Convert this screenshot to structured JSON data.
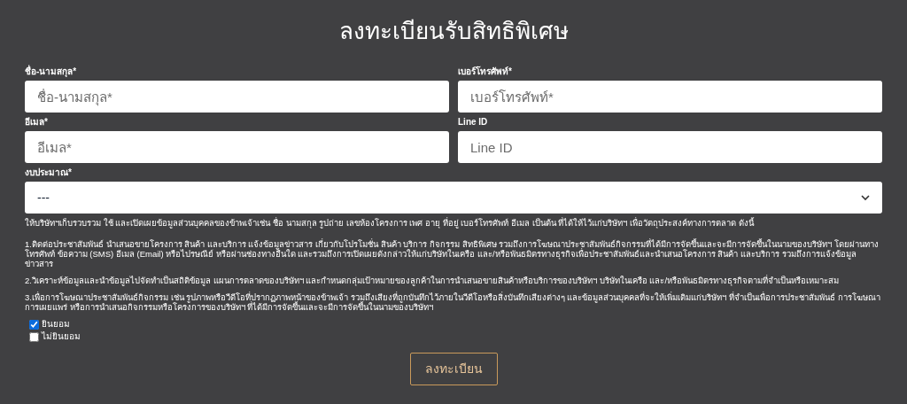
{
  "title": "ลงทะเบียนรับสิทธิพิเศษ",
  "fields": [
    {
      "label": "ชื่อ-นามสกุล*",
      "placeholder": "ชื่อ-นามสกุล*"
    },
    {
      "label": "เบอร์โทรศัพท์*",
      "placeholder": "เบอร์โทรศัพท์*"
    },
    {
      "label": "อีเมล*",
      "placeholder": "อีเมล*"
    },
    {
      "label": "Line ID",
      "placeholder": "Line ID"
    }
  ],
  "budget": {
    "label": "งบประมาณ*",
    "value": "---"
  },
  "consent_intro": "ให้บริษัทฯเก็บรวบรวม ใช้ และเปิดเผยข้อมูลส่วนบุคคลของข้าพเจ้าเช่น ชื่อ นามสกุล รูปถ่าย เลขห้องโครงการ เพศ อายุ ที่อยู่ เบอร์โทรศัพท์ อีเมล เป็นต้น ที่ได้ให้ไว้แก่บริษัทฯ เพื่อวัตถุประสงค์ทางการตลาด ดังนี้",
  "consent_items": [
    "1.ติดต่อประชาสัมพันธ์ นำเสนอขายโครงการ สินค้า และบริการ แจ้งข้อมูลข่าวสาร เกี่ยวกับโปรโมชั่น สินค้า บริการ กิจกรรม สิทธิพิเศษ รวมถึงการโฆษณาประชาสัมพันธ์กิจกรรมที่ได้มีการจัดขึ้นและจะมีการจัดขึ้นในนามของบริษัทฯ โดยผ่านทางโทรศัพท์ ข้อความ (SMS) อีเมล (Email) หรือไปรษณีย์ หรือผ่านช่องทางอื่นใด และรวมถึงการเปิดเผยดังกล่าวให้แก่บริษัทในเครือ และ/หรือพันธมิตรทางธุรกิจเพื่อประชาสัมพันธ์และนำเสนอโครงการ สินค้า และบริการ รวมถึงการแจ้งข้อมูลข่าวสาร",
    "2.วิเคราะห์ข้อมูลและนำข้อมูลไปจัดทำเป็นสถิติข้อมูล แผนการตลาดของบริษัทฯ และกำหนดกลุ่มเป้าหมายของลูกค้าในการนำเสนอขายสินค้าหรือบริการของบริษัทฯ บริษัทในเครือ และ/หรือพันธมิตรทางธุรกิจตามที่จำเป็นหรือเหมาะสม",
    "3.เพื่อการโฆษณาประชาสัมพันธ์กิจกรรม เช่น รูปภาพหรือวีดีโอที่ปรากฏภาพหน้าของข้าพเจ้า รวมถึงเสียงที่ถูกบันทึกไว้ภายในวีดีโอหรือสิ่งบันทึกเสียงต่างๆ และข้อมูลส่วนบุคคลที่จะให้เพิ่มเติมแก่บริษัทฯ ที่จำเป็นเพื่อการประชาสัมพันธ์ การโฆษณา การเผยแพร่ หรือการนำเสนอกิจกรรมหรือโครงการของบริษัทฯ ที่ได้มีการจัดขึ้นและจะมีการจัดขึ้นในนามของบริษัทฯ"
  ],
  "options": [
    {
      "label": "ยินยอม",
      "checked": true
    },
    {
      "label": "ไม่ยินยอม",
      "checked": false
    }
  ],
  "submit": "ลงทะเบียน"
}
